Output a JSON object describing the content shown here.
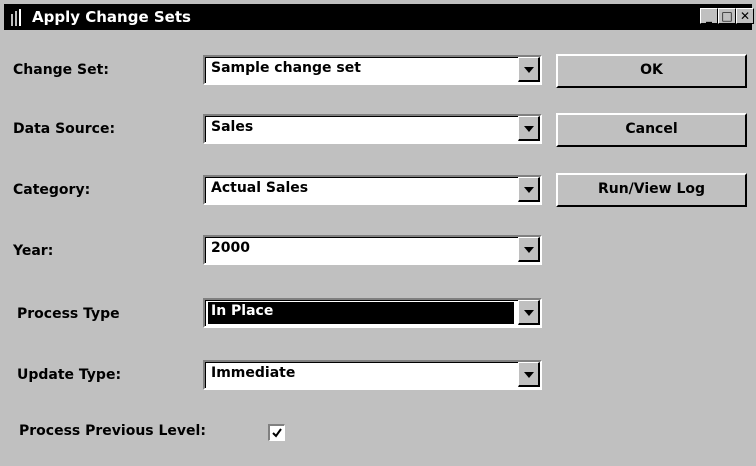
{
  "window": {
    "title": "Apply Change Sets",
    "title_buttons": {
      "minimize": "_",
      "maximize": "□",
      "close": "✕"
    }
  },
  "fields": [
    {
      "label": "Change Set:",
      "value": "Sample change set"
    },
    {
      "label": "Data Source:",
      "value": "Sales"
    },
    {
      "label": "Category:",
      "value": "Actual Sales"
    },
    {
      "label": "Year:",
      "value": "2000"
    },
    {
      "label": "Process Type",
      "value": "In Place"
    },
    {
      "label": "Update Type:",
      "value": "Immediate"
    }
  ],
  "checkbox": {
    "label": "Process Previous Level:",
    "checked": true
  },
  "buttons": {
    "ok": "OK",
    "cancel": "Cancel",
    "run_view_log": "Run/View Log"
  },
  "colors": {
    "face": "#c0c0c0",
    "titlebar": "#000000",
    "field": "#ffffff"
  }
}
